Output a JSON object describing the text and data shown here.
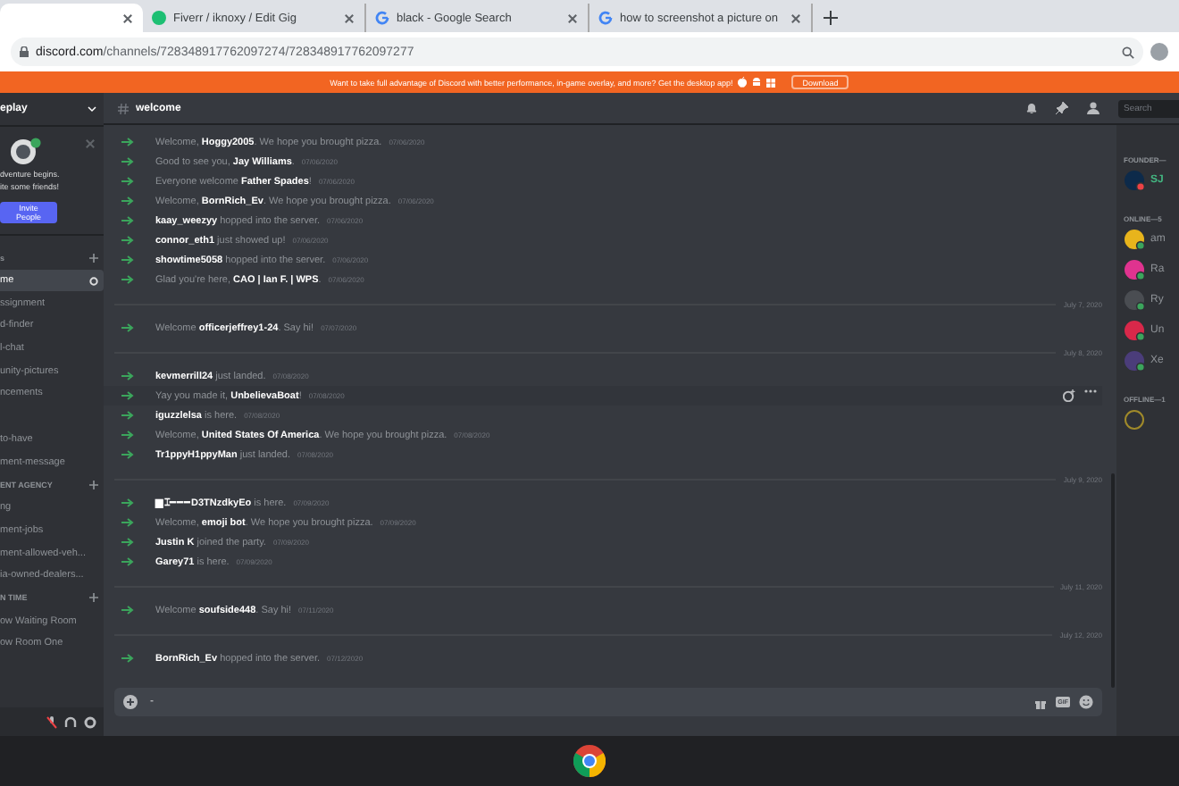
{
  "browser": {
    "tabs": [
      {
        "selected": true,
        "kind": "blank"
      },
      {
        "title": "Fiverr / iknoxy / Edit Gig",
        "selected": false,
        "kind": "fiverr"
      },
      {
        "title": "black - Google Search",
        "selected": false,
        "kind": "google"
      },
      {
        "title": "how to screenshot a picture on",
        "selected": false,
        "kind": "google"
      }
    ],
    "url_host": "discord.com",
    "url_path": "/channels/728348917762097274/728348917762097277"
  },
  "banner": {
    "text": "Want to take full advantage of Discord with better performance, in-game overlay, and more? Get the desktop app!",
    "button": "Download"
  },
  "sidebar": {
    "server_name": "eplay",
    "intro_lines": [
      "dventure begins.",
      "ite some friends!"
    ],
    "invite_button": "Invite People",
    "items": [
      {
        "kind": "category",
        "label": "s"
      },
      {
        "kind": "channel",
        "label": "me",
        "selected": true
      },
      {
        "kind": "channel",
        "label": "ssignment",
        "selected": false
      },
      {
        "kind": "channel",
        "label": "d-finder",
        "selected": false
      },
      {
        "kind": "channel",
        "label": "l-chat",
        "selected": false
      },
      {
        "kind": "channel",
        "label": "unity-pictures",
        "selected": false
      },
      {
        "kind": "channel",
        "label": "ncements",
        "selected": false
      },
      {
        "kind": "gap"
      },
      {
        "kind": "channel",
        "label": "to-have",
        "selected": false
      },
      {
        "kind": "channel",
        "label": "ment-message",
        "selected": false
      },
      {
        "kind": "category",
        "label": "ENT AGENCY"
      },
      {
        "kind": "channel",
        "label": "ng",
        "selected": false
      },
      {
        "kind": "channel",
        "label": "ment-jobs",
        "selected": false
      },
      {
        "kind": "channel",
        "label": "ment-allowed-veh...",
        "selected": false
      },
      {
        "kind": "channel",
        "label": "ia-owned-dealers...",
        "selected": false
      },
      {
        "kind": "category",
        "label": "N TIME"
      },
      {
        "kind": "channel",
        "label": "ow Waiting Room",
        "selected": false
      },
      {
        "kind": "channel",
        "label": "ow Room One",
        "selected": false
      }
    ]
  },
  "channel": {
    "name": "welcome",
    "search_placeholder": "Search"
  },
  "messages": [
    {
      "kind": "join",
      "text": "Welcome, **Hoggy2005**. We hope you brought pizza.",
      "time": "07/06/2020"
    },
    {
      "kind": "join",
      "text": "Good to see you, **Jay Williams**.",
      "time": "07/06/2020"
    },
    {
      "kind": "join",
      "text": "Everyone welcome **Father Spades**!",
      "time": "07/06/2020"
    },
    {
      "kind": "join",
      "text": "Welcome, **BornRich_Ev**. We hope you brought pizza.",
      "time": "07/06/2020"
    },
    {
      "kind": "join",
      "text": "**kaay_weezyy** hopped into the server.",
      "time": "07/06/2020"
    },
    {
      "kind": "join",
      "text": "**connor_eth1** just showed up!",
      "time": "07/06/2020"
    },
    {
      "kind": "join",
      "text": "**showtime5058** hopped into the server.",
      "time": "07/06/2020"
    },
    {
      "kind": "join",
      "text": "Glad you're here, **CAO | Ian F. | WPS**.",
      "time": "07/06/2020"
    },
    {
      "kind": "divider",
      "text": "July 7, 2020"
    },
    {
      "kind": "join",
      "text": "Welcome **officerjeffrey1-24**. Say hi!",
      "time": "07/07/2020"
    },
    {
      "kind": "divider",
      "text": "July 8, 2020"
    },
    {
      "kind": "join",
      "text": "**kevmerrill24** just landed.",
      "time": "07/08/2020"
    },
    {
      "kind": "hovered",
      "text": "Yay you made it, **UnbelievaBoat**!",
      "time": "07/08/2020"
    },
    {
      "kind": "join",
      "text": "**iguzzlelsa** is here.",
      "time": "07/08/2020"
    },
    {
      "kind": "join",
      "text": "Welcome, **United States Of America**. We hope you brought pizza.",
      "time": "07/08/2020"
    },
    {
      "kind": "join",
      "text": "**Tr1ppyH1ppyMan** just landed.",
      "time": "07/08/2020"
    },
    {
      "kind": "divider",
      "text": "July 9, 2020"
    },
    {
      "kind": "join",
      "text": "**▆⌶━━━D3TNzdkyEo** is here.",
      "time": "07/09/2020"
    },
    {
      "kind": "join",
      "text": "Welcome, **emoji bot**. We hope you brought pizza.",
      "time": "07/09/2020"
    },
    {
      "kind": "join",
      "text": "**Justin K** joined the party.",
      "time": "07/09/2020"
    },
    {
      "kind": "join",
      "text": "**Garey71** is here.",
      "time": "07/09/2020"
    },
    {
      "kind": "divider",
      "text": "July 11, 2020"
    },
    {
      "kind": "join",
      "text": "Welcome **soufside448**. Say hi!",
      "time": "07/11/2020"
    },
    {
      "kind": "divider",
      "text": "July 12, 2020"
    },
    {
      "kind": "join",
      "text": "**BornRich_Ev** hopped into the server.",
      "time": "07/12/2020"
    }
  ],
  "composer": {
    "value": "-",
    "gif_label": "GIF"
  },
  "members": [
    {
      "kind": "header",
      "label": "FOUNDER—"
    },
    {
      "kind": "founder",
      "label": "SJ",
      "color": "#0d2a4a"
    },
    {
      "kind": "header",
      "label": "ONLINE—5"
    },
    {
      "kind": "online",
      "label": "am",
      "color": "#e8b41c"
    },
    {
      "kind": "online",
      "label": "Ra",
      "color": "#e0338f"
    },
    {
      "kind": "online",
      "label": "Ry",
      "color": "#4a4d52"
    },
    {
      "kind": "online",
      "label": "Un",
      "color": "#d8284a"
    },
    {
      "kind": "online",
      "label": "Xe",
      "color": "#4b3d7a"
    },
    {
      "kind": "header",
      "label": "OFFLINE—1"
    },
    {
      "kind": "offline"
    }
  ]
}
